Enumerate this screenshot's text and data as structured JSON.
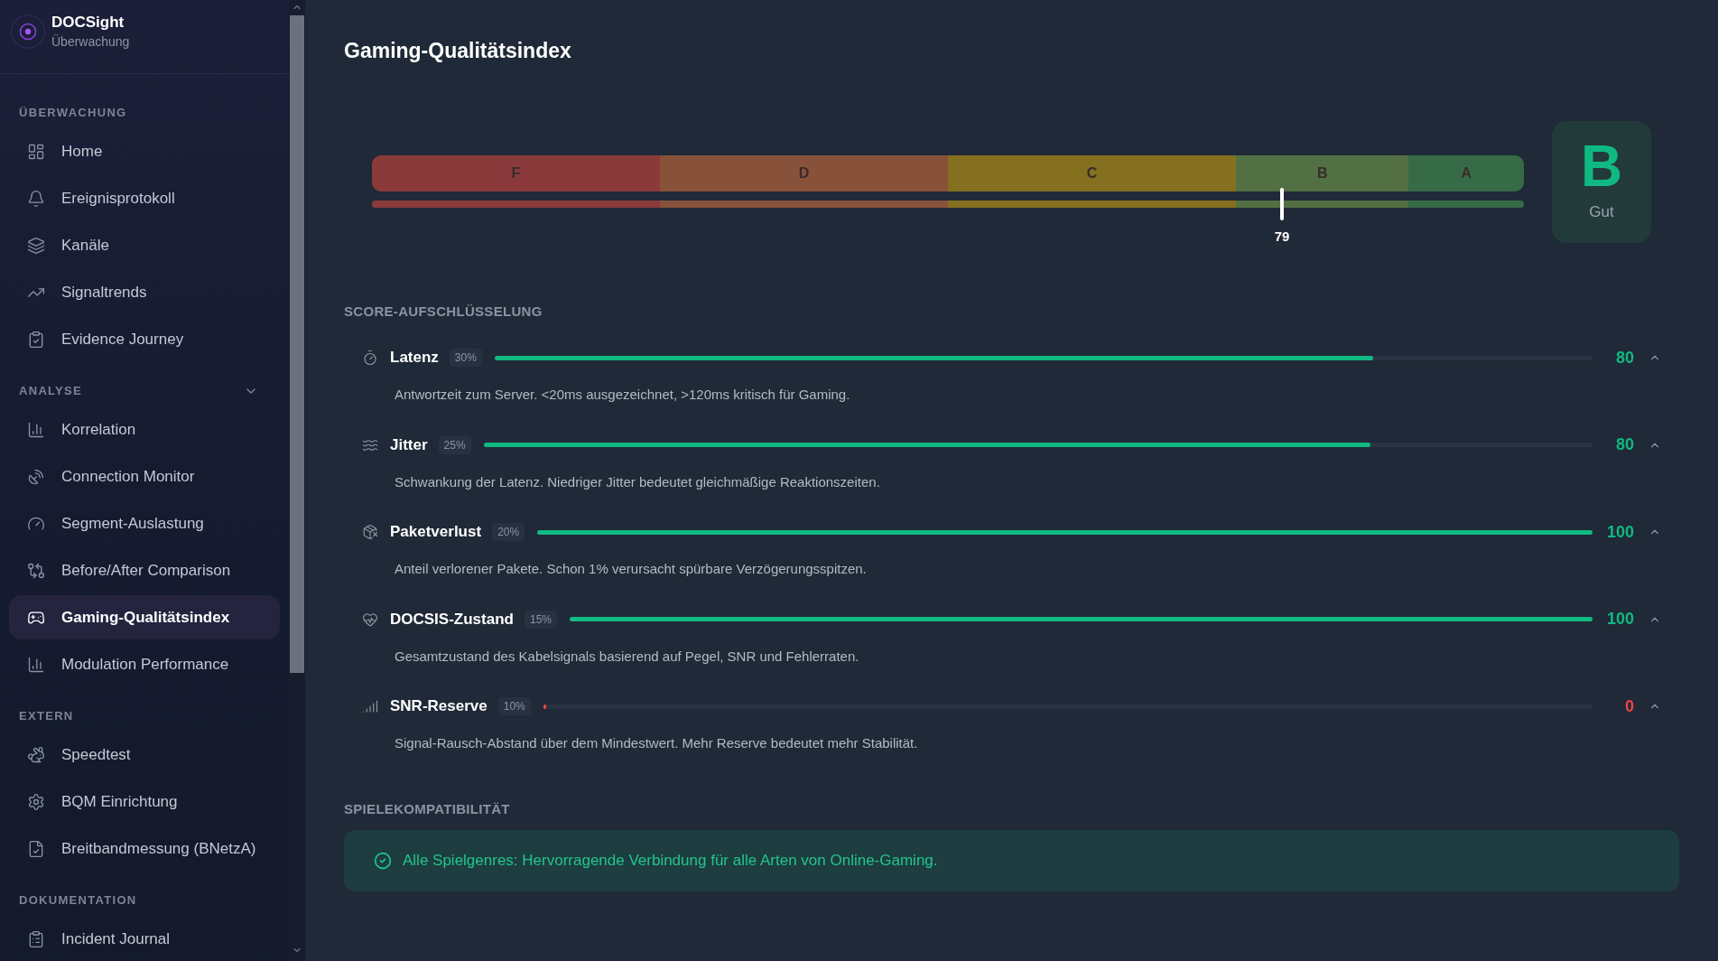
{
  "sidebar": {
    "brand": {
      "name": "DOCSight",
      "subtitle": "Überwachung"
    },
    "sections": [
      {
        "title": "ÜBERWACHUNG",
        "items": [
          {
            "label": "Home",
            "selected": false
          },
          {
            "label": "Ereignisprotokoll",
            "selected": false
          },
          {
            "label": "Kanäle",
            "selected": false
          },
          {
            "label": "Signaltrends",
            "selected": false
          },
          {
            "label": "Evidence Journey",
            "selected": false
          }
        ]
      },
      {
        "title": "ANALYSE",
        "expanded": true,
        "items": [
          {
            "label": "Korrelation",
            "selected": false
          },
          {
            "label": "Connection Monitor",
            "selected": false
          },
          {
            "label": "Segment-Auslastung",
            "selected": false
          },
          {
            "label": "Before/After Comparison",
            "selected": false
          },
          {
            "label": "Gaming-Qualitätsindex",
            "selected": true
          },
          {
            "label": "Modulation Performance",
            "selected": false
          }
        ]
      },
      {
        "title": "EXTERN",
        "items": [
          {
            "label": "Speedtest",
            "selected": false
          },
          {
            "label": "BQM Einrichtung",
            "selected": false
          },
          {
            "label": "Breitbandmessung (BNetzA)",
            "selected": false
          }
        ]
      },
      {
        "title": "DOKUMENTATION",
        "items": [
          {
            "label": "Incident Journal",
            "selected": false
          }
        ]
      }
    ]
  },
  "page": {
    "title": "Gaming-Qualitätsindex"
  },
  "gauge": {
    "segments": [
      {
        "label": "F",
        "color": "#8b3a3c"
      },
      {
        "label": "D",
        "color": "#88523a"
      },
      {
        "label": "C",
        "color": "#85701f"
      },
      {
        "label": "B",
        "color": "#527043"
      },
      {
        "label": "A",
        "color": "#376b47"
      }
    ],
    "marker": {
      "level": 0.79,
      "reading": "79"
    },
    "grade": {
      "letter": "B",
      "label": "Gut"
    }
  },
  "breakdown": {
    "title": "SCORE-AUFSCHLÜSSELUNG",
    "rows": [
      {
        "name": "Latenz",
        "weight": "30%",
        "level": 0.8,
        "value": "80",
        "color": "#10b981",
        "expanded": true,
        "description": "Antwortzeit zum Server. <20ms ausgezeichnet, >120ms kritisch für Gaming."
      },
      {
        "name": "Jitter",
        "weight": "25%",
        "level": 0.8,
        "value": "80",
        "color": "#10b981",
        "expanded": true,
        "description": "Schwankung der Latenz. Niedriger Jitter bedeutet gleichmäßige Reaktionszeiten."
      },
      {
        "name": "Paketverlust",
        "weight": "20%",
        "level": 1,
        "value": "100",
        "color": "#10b981",
        "expanded": true,
        "description": "Anteil verlorener Pakete. Schon 1% verursacht spürbare Verzögerungsspitzen."
      },
      {
        "name": "DOCSIS-Zustand",
        "weight": "15%",
        "level": 1,
        "value": "100",
        "color": "#10b981",
        "expanded": true,
        "description": "Gesamtzustand des Kabelsignals basierend auf Pegel, SNR und Fehlerraten."
      },
      {
        "name": "SNR-Reserve",
        "weight": "10%",
        "level": 0,
        "value": "0",
        "color": "#ef4444",
        "expanded": true,
        "description": "Signal-Rausch-Abstand über dem Mindestwert. Mehr Reserve bedeutet mehr Stabilität."
      }
    ]
  },
  "compatibility": {
    "title": "SPIELEKOMPATIBILITÄT",
    "message": "Alle Spielgenres: Hervorragende Verbindung für alle Arten von Online-Gaming."
  }
}
